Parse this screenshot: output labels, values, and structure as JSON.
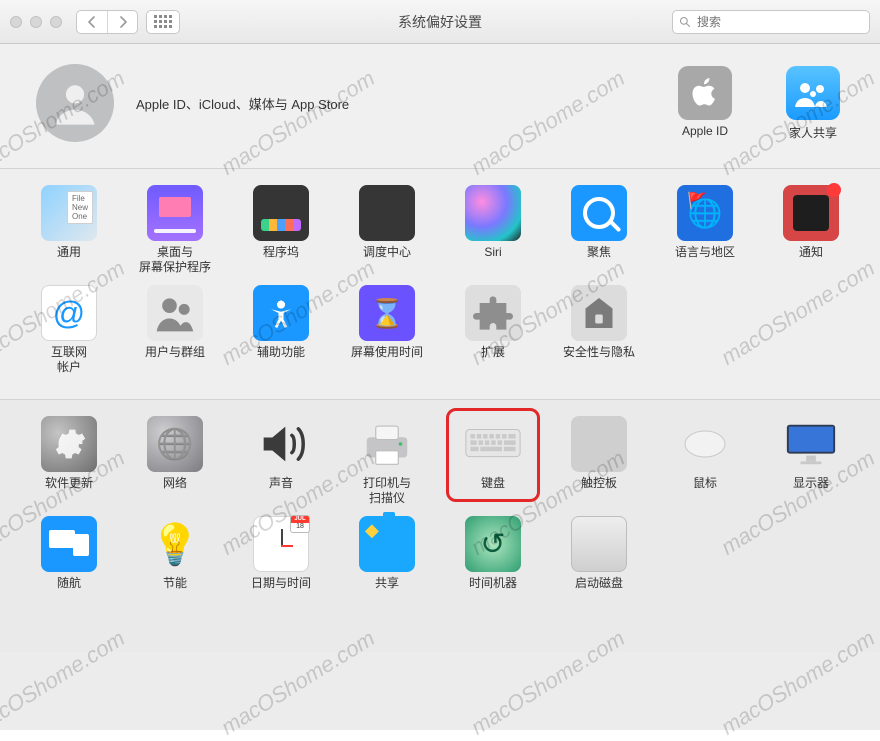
{
  "window": {
    "title": "系统偏好设置"
  },
  "search": {
    "placeholder": "搜索"
  },
  "account": {
    "caption": "Apple ID、iCloud、媒体与 App Store",
    "right": [
      {
        "key": "apple-id",
        "label": "Apple ID"
      },
      {
        "key": "family",
        "label": "家人共享"
      }
    ]
  },
  "sections": [
    {
      "id": "row1",
      "items": [
        {
          "key": "general",
          "label": "通用"
        },
        {
          "key": "desktop",
          "label": "桌面与\n屏幕保护程序"
        },
        {
          "key": "dock",
          "label": "程序坞"
        },
        {
          "key": "mission",
          "label": "调度中心"
        },
        {
          "key": "siri",
          "label": "Siri"
        },
        {
          "key": "spotlight",
          "label": "聚焦"
        },
        {
          "key": "language",
          "label": "语言与地区"
        },
        {
          "key": "notifications",
          "label": "通知"
        }
      ]
    },
    {
      "id": "row2",
      "items": [
        {
          "key": "internet-accounts",
          "label": "互联网\n帐户"
        },
        {
          "key": "users-groups",
          "label": "用户与群组"
        },
        {
          "key": "accessibility",
          "label": "辅助功能"
        },
        {
          "key": "screen-time",
          "label": "屏幕使用时间"
        },
        {
          "key": "extensions",
          "label": "扩展"
        },
        {
          "key": "security",
          "label": "安全性与隐私"
        }
      ]
    },
    {
      "id": "row3",
      "items": [
        {
          "key": "software-update",
          "label": "软件更新"
        },
        {
          "key": "network",
          "label": "网络"
        },
        {
          "key": "sound",
          "label": "声音"
        },
        {
          "key": "printers",
          "label": "打印机与\n扫描仪"
        },
        {
          "key": "keyboard",
          "label": "键盘",
          "highlight": true
        },
        {
          "key": "trackpad",
          "label": "触控板"
        },
        {
          "key": "mouse",
          "label": "鼠标"
        },
        {
          "key": "displays",
          "label": "显示器"
        }
      ]
    },
    {
      "id": "row4",
      "items": [
        {
          "key": "sidecar",
          "label": "随航"
        },
        {
          "key": "energy",
          "label": "节能"
        },
        {
          "key": "date-time",
          "label": "日期与时间"
        },
        {
          "key": "sharing",
          "label": "共享"
        },
        {
          "key": "time-machine",
          "label": "时间机器"
        },
        {
          "key": "startup-disk",
          "label": "启动磁盘"
        }
      ]
    }
  ],
  "date_badge": {
    "month": "JUL",
    "day": "18"
  },
  "watermark": "macOShome.com"
}
